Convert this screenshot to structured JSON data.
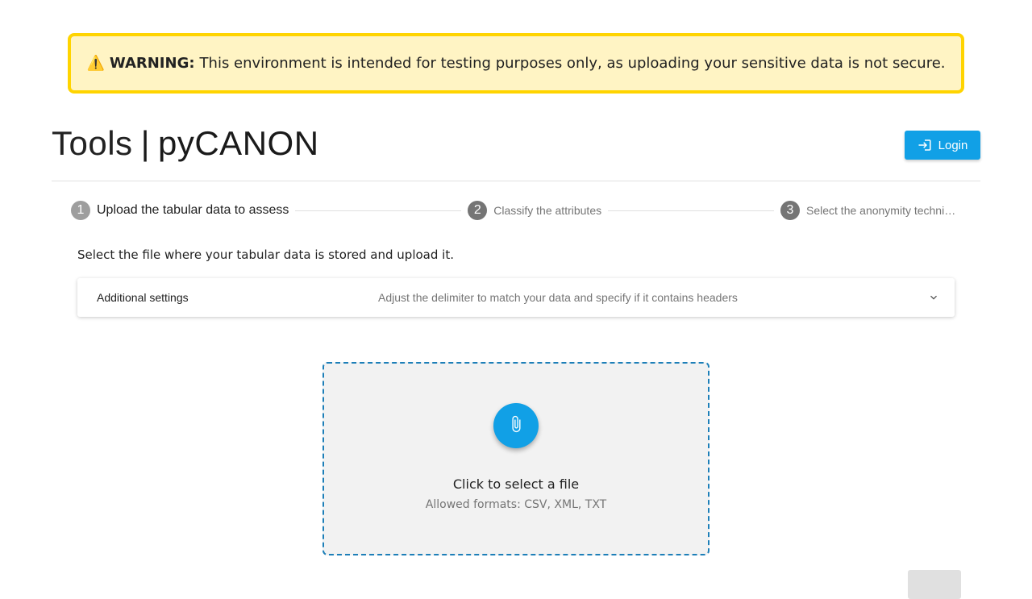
{
  "warning": {
    "icon": "warning-icon",
    "strong": "WARNING:",
    "message": "This environment is intended for testing purposes only, as uploading your sensitive data is not secure."
  },
  "header": {
    "title_prefix": "Tools",
    "title_separator": "|",
    "title_main": "pyCANON",
    "login_label": "Login",
    "login_icon": "login-icon"
  },
  "stepper": {
    "steps": [
      {
        "number": "1",
        "label": "Upload the tabular data to assess"
      },
      {
        "number": "2",
        "label": "Classify the attributes"
      },
      {
        "number": "3",
        "label": "Select the anonymity techniq…"
      }
    ]
  },
  "main": {
    "instruction": "Select the file where your tabular data is stored and upload it.",
    "settings": {
      "title": "Additional settings",
      "description": "Adjust the delimiter to match your data and specify if it contains headers",
      "chevron_icon": "chevron-down-icon"
    },
    "dropzone": {
      "icon": "paperclip-icon",
      "main_text": "Click to select a file",
      "sub_text": "Allowed formats: CSV, XML, TXT"
    }
  },
  "colors": {
    "accent": "#11a0e6",
    "warning_bg": "#fff4c4",
    "warning_border": "#ffd400",
    "dropzone_border": "#1d7fb8"
  }
}
